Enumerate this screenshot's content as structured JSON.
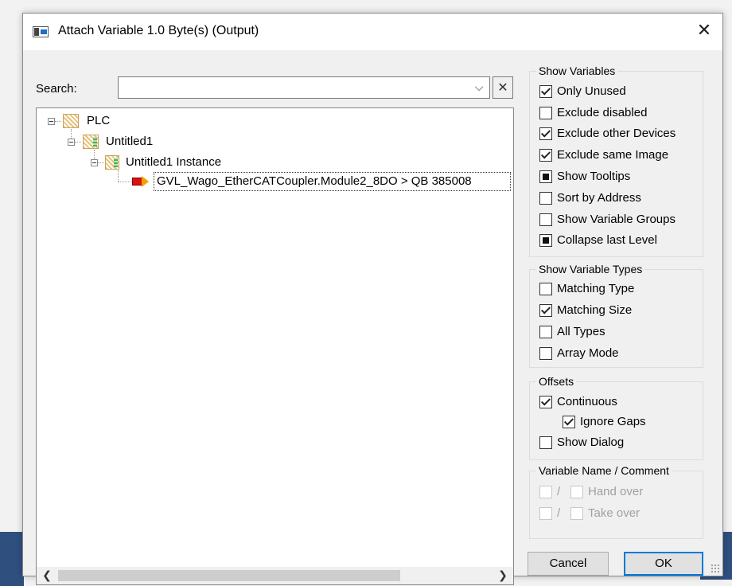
{
  "window": {
    "title": "Attach Variable 1.0 Byte(s) (Output)"
  },
  "search": {
    "label": "Search:",
    "value": "",
    "placeholder": ""
  },
  "tree": {
    "plc": "PLC",
    "project": "Untitled1",
    "instance": "Untitled1 Instance",
    "selected_variable": "GVL_Wago_EtherCATCoupler.Module2_8DO   >   QB 385008"
  },
  "show_variables": {
    "title": "Show Variables",
    "options": [
      {
        "label": "Only Unused",
        "state": "checked"
      },
      {
        "label": "Exclude disabled",
        "state": "unchecked"
      },
      {
        "label": "Exclude other Devices",
        "state": "checked"
      },
      {
        "label": "Exclude same Image",
        "state": "checked"
      },
      {
        "label": "Show Tooltips",
        "state": "indeterminate"
      },
      {
        "label": "Sort by Address",
        "state": "unchecked"
      },
      {
        "label": "Show Variable Groups",
        "state": "unchecked"
      },
      {
        "label": "Collapse last Level",
        "state": "indeterminate"
      }
    ]
  },
  "show_variable_types": {
    "title": "Show Variable Types",
    "options": [
      {
        "label": "Matching Type",
        "state": "unchecked"
      },
      {
        "label": "Matching Size",
        "state": "checked"
      },
      {
        "label": "All Types",
        "state": "unchecked"
      },
      {
        "label": "Array Mode",
        "state": "unchecked"
      }
    ]
  },
  "offsets": {
    "title": "Offsets",
    "continuous": "Continuous",
    "ignore_gaps": "Ignore Gaps",
    "show_dialog": "Show Dialog"
  },
  "variable_name_comment": {
    "title": "Variable Name / Comment",
    "separator": "/",
    "hand_over": "Hand over",
    "take_over": "Take over"
  },
  "buttons": {
    "cancel": "Cancel",
    "ok": "OK"
  }
}
